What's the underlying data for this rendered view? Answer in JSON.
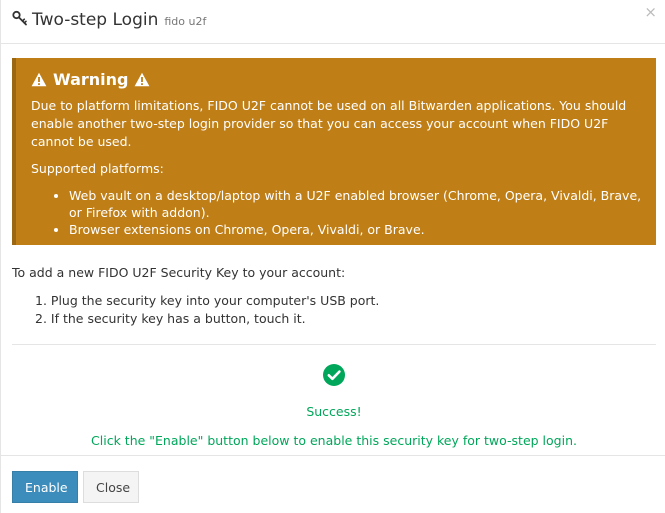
{
  "header": {
    "title": "Two-step Login",
    "subtitle": "fido u2f",
    "title_icon": "key-icon",
    "close_label": "×"
  },
  "warning": {
    "title": "Warning",
    "icon": "warning-triangle-icon",
    "message": "Due to platform limitations, FIDO U2F cannot be used on all Bitwarden applications. You should enable another two-step login provider so that you can access your account when FIDO U2F cannot be used.",
    "supported_label": "Supported platforms:",
    "platforms": [
      "Web vault on a desktop/laptop with a U2F enabled browser (Chrome, Opera, Vivaldi, Brave, or Firefox with addon).",
      "Browser extensions on Chrome, Opera, Vivaldi, or Brave."
    ],
    "colors": {
      "background": "#bf7e16",
      "border": "#9c6712",
      "text": "#ffffff"
    }
  },
  "instructions": {
    "intro": "To add a new FIDO U2F Security Key to your account:",
    "steps": [
      "1. Plug the security key into your computer's USB port.",
      "2. If the security key has a button, touch it."
    ]
  },
  "status": {
    "icon": "check-circle-icon",
    "title": "Success!",
    "message": "Click the \"Enable\" button below to enable this security key for two-step login.",
    "color": "#00a65a"
  },
  "footer": {
    "enable_label": "Enable",
    "close_label": "Close",
    "primary_color": "#3c8dbc"
  }
}
